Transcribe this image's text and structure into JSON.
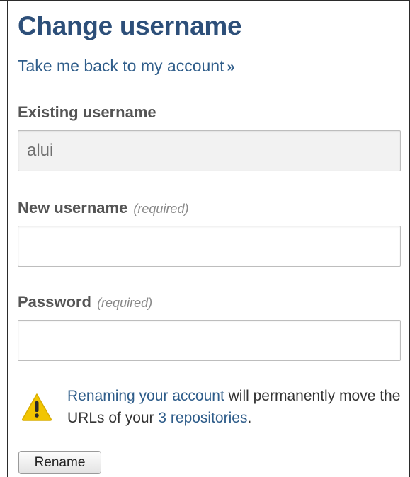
{
  "page": {
    "title": "Change username",
    "back_link": "Take me back to my account",
    "back_link_arrow": "»"
  },
  "form": {
    "existing_label": "Existing username",
    "existing_value": "alui",
    "new_label": "New username",
    "new_required": "(required)",
    "new_value": "",
    "password_label": "Password",
    "password_required": "(required)",
    "password_value": ""
  },
  "warning": {
    "icon": "warning-triangle",
    "link_text": "Renaming your account",
    "text_middle": " will permanently move the URLs of your ",
    "repos_link": "3 repositories",
    "text_end": "."
  },
  "actions": {
    "rename_label": "Rename"
  },
  "colors": {
    "title": "#2d4f79",
    "link": "#2f5d8a",
    "warning_icon": "#f2c500"
  }
}
